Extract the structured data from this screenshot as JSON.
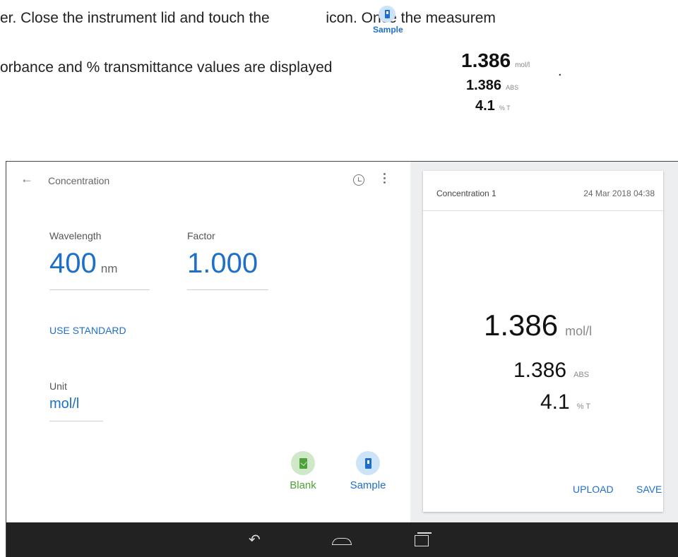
{
  "document": {
    "line1_before": "er. Close the instrument lid and touch the",
    "line1_after": "icon. Once the measurem",
    "line2": "orbance and % transmittance values are displayed",
    "period": ".",
    "inline_icon_label": "Sample",
    "mini_readout": {
      "conc_value": "1.386",
      "conc_unit": "mol/l",
      "abs_value": "1.386",
      "abs_unit": "ABS",
      "trans_value": "4.1",
      "trans_unit": "% T"
    }
  },
  "app": {
    "title": "Concentration",
    "wavelength": {
      "label": "Wavelength",
      "value": "400",
      "unit": "nm"
    },
    "factor": {
      "label": "Factor",
      "value": "1.000"
    },
    "use_standard": "USE STANDARD",
    "unit": {
      "label": "Unit",
      "value": "mol/l"
    },
    "actions": {
      "blank": "Blank",
      "sample": "Sample"
    }
  },
  "result_card": {
    "title": "Concentration 1",
    "date": "24 Mar 2018 04:38",
    "concentration": {
      "value": "1.386",
      "unit": "mol/l"
    },
    "absorbance": {
      "value": "1.386",
      "unit": "ABS"
    },
    "transmittance": {
      "value": "4.1",
      "unit": "% T"
    },
    "upload_label": "UPLOAD",
    "save_label": "SAVE"
  },
  "colors": {
    "accent": "#1e6fc9",
    "blank_green": "#4fa23a",
    "navbar": "#222222"
  }
}
